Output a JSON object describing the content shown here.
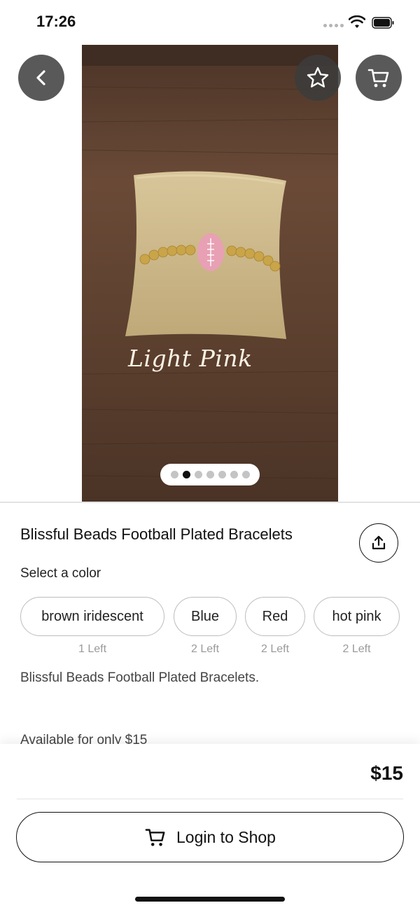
{
  "status": {
    "time": "17:26"
  },
  "hero": {
    "caption": "Light Pink",
    "dot_count": 7,
    "active_dot": 1
  },
  "product": {
    "title": "Blissful Beads Football Plated Bracelets",
    "select_label": "Select a color",
    "colors": [
      {
        "label": "brown iridescent",
        "stock": "1 Left"
      },
      {
        "label": "Blue",
        "stock": "2 Left"
      },
      {
        "label": "Red",
        "stock": "2 Left"
      },
      {
        "label": "hot pink",
        "stock": "2 Left"
      }
    ],
    "description": "Blissful Beads Football Plated Bracelets.",
    "availability": "Available for only $15"
  },
  "footer": {
    "price": "$15",
    "login_button": "Login to Shop"
  },
  "icons": {
    "back": "chevron-left-icon",
    "favorite": "star-icon",
    "cart": "cart-icon",
    "share": "share-icon"
  },
  "colors_theme": {
    "overlay_button": "#3c3c3c",
    "text": "#111111",
    "muted": "#9a9a9a"
  }
}
